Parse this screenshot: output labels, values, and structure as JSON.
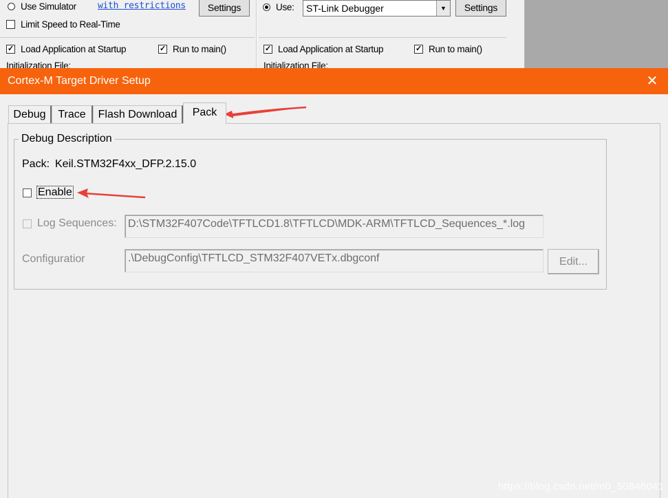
{
  "background_window": {
    "use_simulator_label": "Use Simulator",
    "restrictions_link": "with restrictions",
    "settings_left": "Settings",
    "limit_speed_label": "Limit Speed to Real-Time",
    "load_app_left": "Load Application at Startup",
    "run_to_main_left": "Run to main()",
    "init_file_left": "Initialization File:",
    "use_label": "Use:",
    "debugger_value": "ST-Link Debugger",
    "settings_right": "Settings",
    "load_app_right": "Load Application at Startup",
    "run_to_main_right": "Run to main()",
    "init_file_right": "Initialization File:"
  },
  "dialog": {
    "title": "Cortex-M Target Driver Setup",
    "close_glyph": "✕",
    "tabs": [
      {
        "label": "Debug"
      },
      {
        "label": "Trace"
      },
      {
        "label": "Flash Download"
      },
      {
        "label": "Pack",
        "active": true
      }
    ],
    "group_title": "Debug Description",
    "pack_label": "Pack:",
    "pack_value": "Keil.STM32F4xx_DFP.2.15.0",
    "enable_label": "Enable",
    "enable_checked": false,
    "log_sequences_label": "Log Sequences:",
    "log_sequences_value": "D:\\STM32F407Code\\TFTLCD1.8\\TFTLCD\\MDK-ARM\\TFTLCD_Sequences_*.log",
    "configuration_label": "Configuratior",
    "configuration_value": ".\\DebugConfig\\TFTLCD_STM32F407VETx.dbgconf",
    "edit_button": "Edit..."
  },
  "colors": {
    "titlebar": "#f7630c",
    "annotation_arrow": "#e8403a"
  },
  "icons": {
    "close": "close-icon",
    "checkmark": "checkmark-icon",
    "dropdown": "chevron-down-icon"
  },
  "watermark": "https://blog.csdn.net/m0_50846041"
}
